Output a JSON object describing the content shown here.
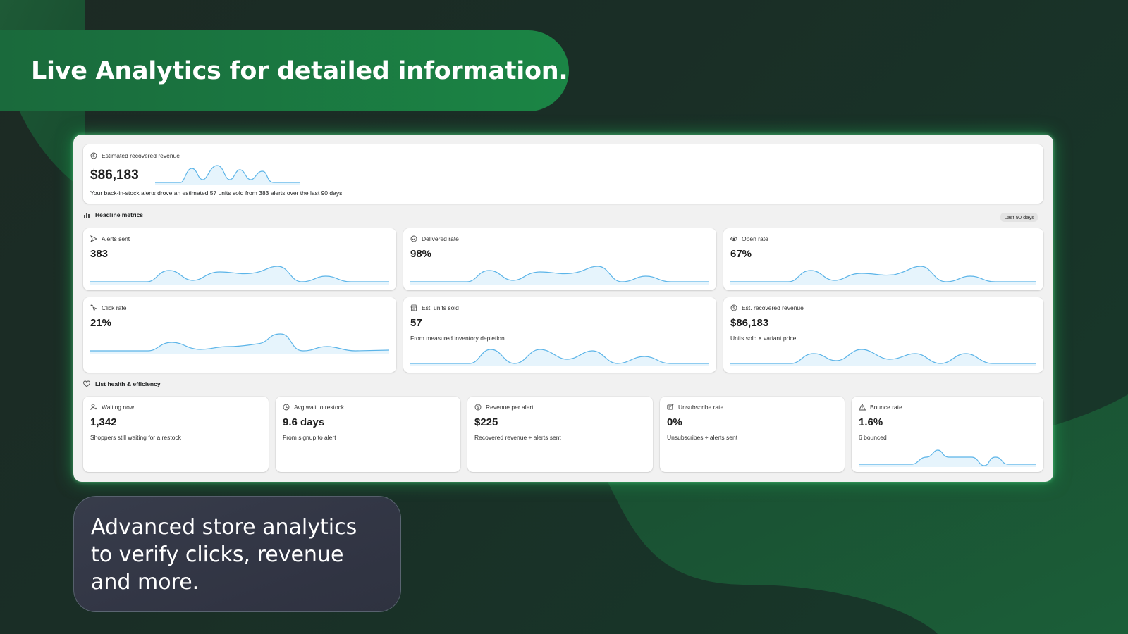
{
  "headline": "Live Analytics for detailed information.",
  "caption": "Advanced store analytics to verify clicks, revenue and more.",
  "colors": {
    "accent_green": "#1b8545",
    "spark_line": "#5bb4e8",
    "spark_fill": "#d6ecfa"
  },
  "hero": {
    "label": "Estimated recovered revenue",
    "icon": "dollar-circle-icon",
    "value": "$86,183",
    "description": "Your back-in-stock alerts drove an estimated 57 units sold from 383 alerts over the last 90 days."
  },
  "headline_metrics": {
    "title": "Headline metrics",
    "icon": "bar-chart-icon",
    "period": "Last 90 days",
    "cards": [
      {
        "label": "Alerts sent",
        "icon": "send-icon",
        "value": "383",
        "sub": ""
      },
      {
        "label": "Delivered rate",
        "icon": "check-circle-icon",
        "value": "98%",
        "sub": ""
      },
      {
        "label": "Open rate",
        "icon": "eye-icon",
        "value": "67%",
        "sub": ""
      },
      {
        "label": "Click rate",
        "icon": "cursor-click-icon",
        "value": "21%",
        "sub": ""
      },
      {
        "label": "Est. units sold",
        "icon": "store-icon",
        "value": "57",
        "sub": "From measured inventory depletion"
      },
      {
        "label": "Est. recovered revenue",
        "icon": "dollar-circle-icon",
        "value": "$86,183",
        "sub": "Units sold × variant price"
      }
    ]
  },
  "list_health": {
    "title": "List health & efficiency",
    "icon": "heart-icon",
    "cards": [
      {
        "label": "Waiting now",
        "icon": "person-icon",
        "value": "1,342",
        "sub": "Shoppers still waiting for a restock"
      },
      {
        "label": "Avg wait to restock",
        "icon": "clock-icon",
        "value": "9.6 days",
        "sub": "From signup to alert"
      },
      {
        "label": "Revenue per alert",
        "icon": "dollar-circle-icon",
        "value": "$225",
        "sub": "Recovered revenue ÷ alerts sent"
      },
      {
        "label": "Unsubscribe rate",
        "icon": "unsubscribe-icon",
        "value": "0%",
        "sub": "Unsubscribes ÷ alerts sent"
      },
      {
        "label": "Bounce rate",
        "icon": "warning-icon",
        "value": "1.6%",
        "sub": "6 bounced"
      }
    ]
  }
}
